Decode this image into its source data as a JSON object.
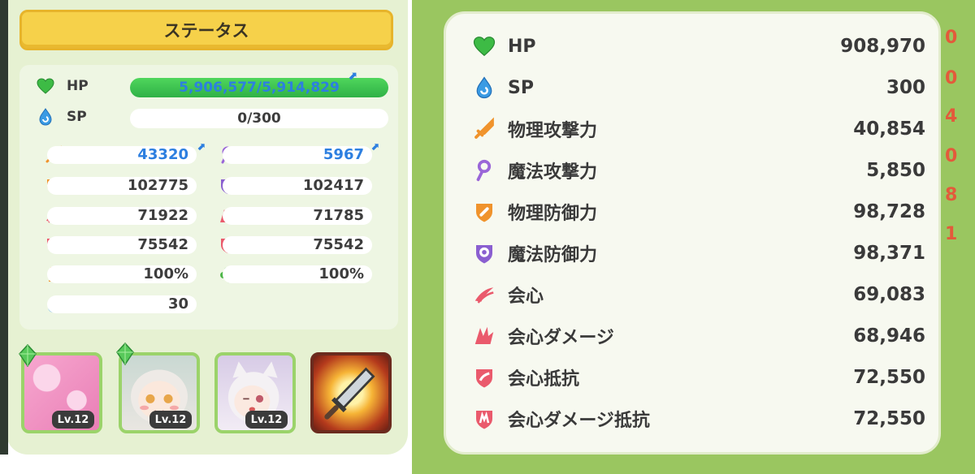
{
  "left": {
    "title": "ステータス",
    "hp": {
      "label": "HP",
      "value": "5,906,577/5,914,829",
      "fill": 0.9986,
      "up": "⬈"
    },
    "sp": {
      "label": "SP",
      "value": "0/300"
    },
    "stats": [
      {
        "left": "43320",
        "left_up": true,
        "right": "5967",
        "right_up": true
      },
      {
        "left": "102775",
        "right": "102417"
      },
      {
        "left": "71922",
        "right": "71785"
      },
      {
        "left": "75542",
        "right": "75542"
      },
      {
        "left": "100%",
        "right": "100%"
      },
      {
        "left": "30"
      }
    ],
    "cards": [
      {
        "level": "Lv.12"
      },
      {
        "level": "Lv.12"
      },
      {
        "level": "Lv.12"
      }
    ]
  },
  "right": {
    "rows": [
      {
        "name": "HP",
        "value": "908,970",
        "icon": "heart-icon"
      },
      {
        "name": "SP",
        "value": "300",
        "icon": "water-drop-icon"
      },
      {
        "name": "物理攻撃力",
        "value": "40,854",
        "icon": "sword-icon"
      },
      {
        "name": "魔法攻撃力",
        "value": "5,850",
        "icon": "magic-staff-icon"
      },
      {
        "name": "物理防御力",
        "value": "98,728",
        "icon": "physical-shield-icon"
      },
      {
        "name": "魔法防御力",
        "value": "98,371",
        "icon": "magic-shield-icon"
      },
      {
        "name": "会心",
        "value": "69,083",
        "icon": "critical-slash-icon"
      },
      {
        "name": "会心ダメージ",
        "value": "68,946",
        "icon": "critical-damage-icon"
      },
      {
        "name": "会心抵抗",
        "value": "72,550",
        "icon": "critical-resist-icon"
      },
      {
        "name": "会心ダメージ抵抗",
        "value": "72,550",
        "icon": "critical-damage-resist-icon"
      }
    ],
    "side_digits": [
      "0",
      "0",
      "4",
      "0",
      "8",
      "1"
    ]
  },
  "colors": {
    "hp_green": "#3dc453",
    "value_blue": "#2d7fe0",
    "header_yellow": "#f6d14a",
    "panel_green": "#9ac660"
  }
}
